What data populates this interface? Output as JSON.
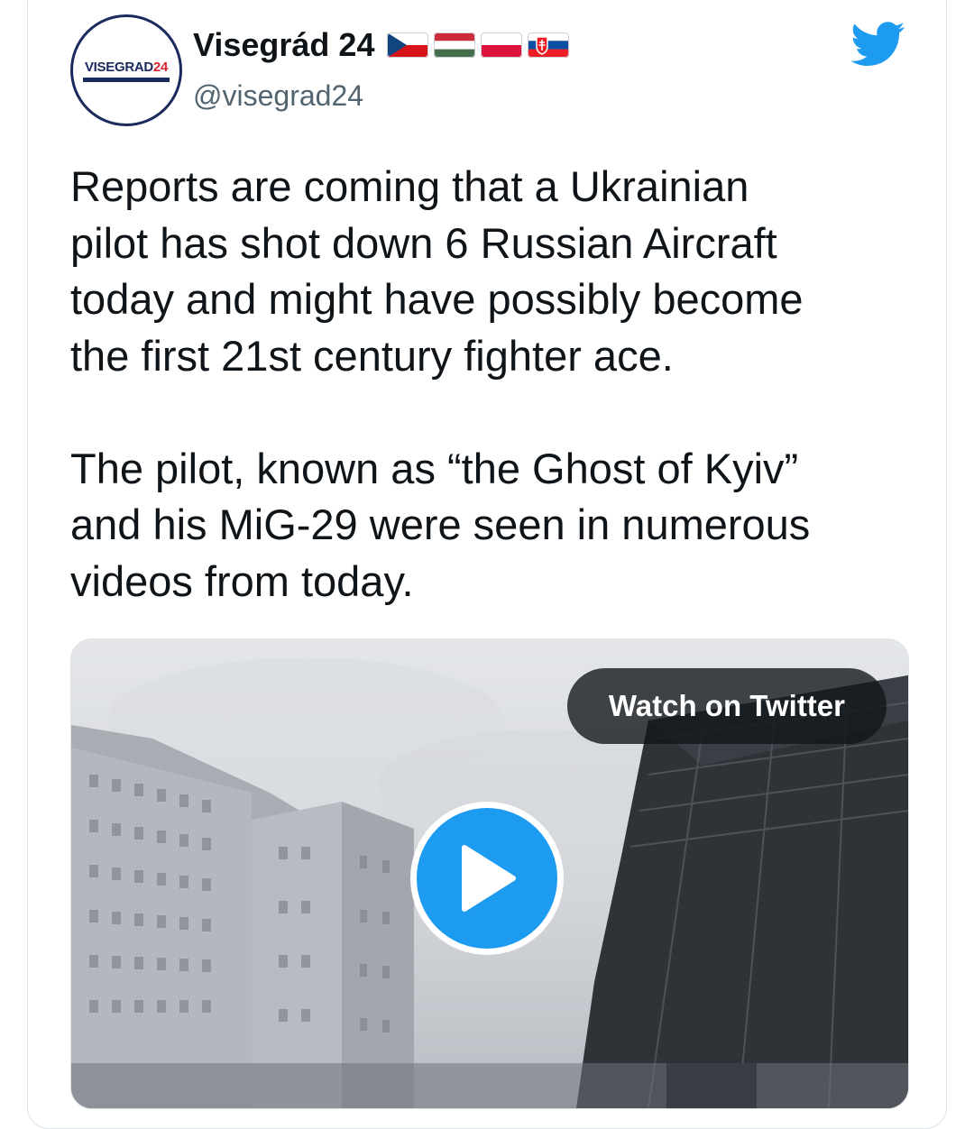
{
  "tweet": {
    "author": {
      "display_name": "Visegrád 24",
      "handle": "@visegrad24",
      "avatar_text_main": "VISEGRAD",
      "avatar_text_num": "24",
      "flags": [
        "czech-flag",
        "hungary-flag",
        "poland-flag",
        "slovakia-flag"
      ]
    },
    "body": "Reports are coming that a Ukrainian\npilot has shot down 6 Russian Aircraft\ntoday and might have possibly become\nthe first 21st century fighter ace.\n\nThe pilot, known as “the Ghost of Kyiv”\nand his MiG-29 were seen in numerous\nvideos from today.",
    "media": {
      "watch_label": "Watch on Twitter",
      "play_icon": "play-icon"
    }
  },
  "colors": {
    "twitter_blue": "#1d9bf0",
    "text": "#0f1419",
    "secondary_text": "#536471",
    "border": "#dfe3e7"
  }
}
